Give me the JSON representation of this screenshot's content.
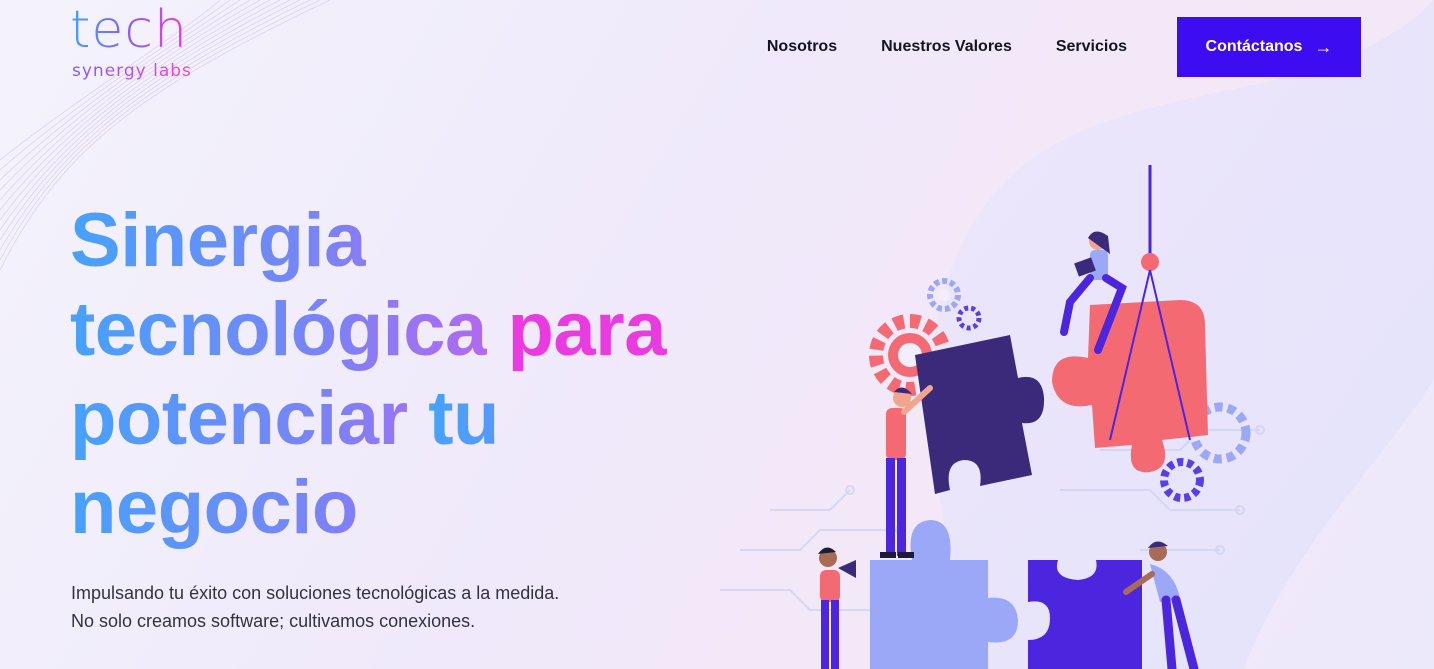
{
  "logo": {
    "main": "tech",
    "sub": "synergy labs"
  },
  "nav": {
    "links": [
      "Nosotros",
      "Nuestros Valores",
      "Servicios"
    ],
    "cta_label": "Contáctanos",
    "cta_icon": "arrow-right-icon"
  },
  "hero": {
    "title_lines": [
      "Sinergia",
      "tecnológica",
      "para",
      "potenciar",
      "tu",
      "negocio"
    ],
    "subtitle_lines": [
      "Impulsando tu éxito con soluciones tecnológicas a la medida.",
      "No solo creamos software; cultivamos conexiones."
    ]
  },
  "colors": {
    "cta_background": "#3d0cf0",
    "gradient_start": "#46a2fb",
    "gradient_end": "#f22fd8",
    "puzzle_coral": "#f46a72",
    "puzzle_navy": "#3b2a7a",
    "puzzle_violet": "#4c25df",
    "puzzle_lavender": "#9aa8f7"
  }
}
